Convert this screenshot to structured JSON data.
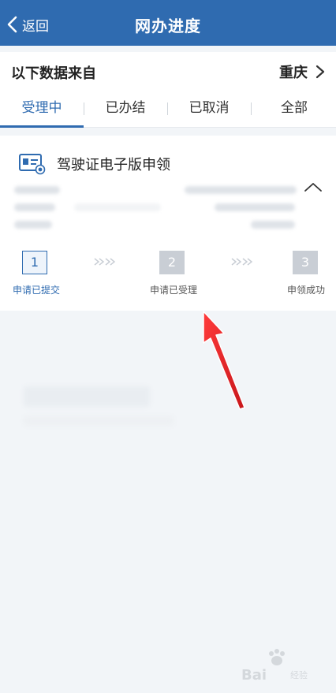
{
  "header": {
    "back_label": "返回",
    "title": "网办进度"
  },
  "source": {
    "label": "以下数据来自",
    "city": "重庆"
  },
  "tabs": [
    {
      "label": "受理中",
      "active": true
    },
    {
      "label": "已办结",
      "active": false
    },
    {
      "label": "已取消",
      "active": false
    },
    {
      "label": "全部",
      "active": false
    }
  ],
  "card": {
    "title": "驾驶证电子版申领",
    "steps": [
      {
        "number": "1",
        "label": "申请已提交",
        "state": "done"
      },
      {
        "number": "2",
        "label": "申请已受理",
        "state": "todo"
      },
      {
        "number": "3",
        "label": "申领成功",
        "state": "todo"
      }
    ]
  },
  "watermark": {
    "text": "Bai",
    "sub": "经验"
  },
  "colors": {
    "primary": "#2f6bb0",
    "background": "#f2f5f8",
    "arrow": "#e0262a"
  }
}
